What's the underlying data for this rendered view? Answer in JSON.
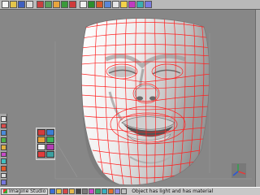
{
  "taskbar": {
    "start_label": "Imagine Studio",
    "status": "Object has light and has material"
  },
  "colors": {
    "background": "#878787",
    "wireframe": "#ff2020",
    "axis_x": "#e33b3b",
    "axis_y": "#2fa34a",
    "axis_z": "#2a56d6"
  },
  "icons": {
    "top_toolbar": [
      "file-new-icon",
      "open-icon",
      "save-icon",
      "print-icon",
      "cut-icon",
      "copy-icon",
      "paste-icon",
      "undo-icon",
      "redo-icon",
      "select-icon",
      "move-icon",
      "rotate-icon",
      "scale-icon",
      "camera-icon",
      "light-icon",
      "render-icon",
      "material-icon",
      "help-icon"
    ],
    "left_toolbar": [
      "select-tool-icon",
      "pan-tool-icon",
      "zoom-tool-icon",
      "orbit-tool-icon",
      "point-tool-icon",
      "edge-tool-icon",
      "face-tool-icon",
      "delete-tool-icon",
      "grid-tool-icon",
      "snap-tool-icon"
    ],
    "palette": [
      "paint-icon",
      "fill-icon",
      "brush-icon",
      "spray-icon",
      "eraser-icon",
      "pick-icon",
      "smudge-icon",
      "stamp-icon"
    ]
  }
}
